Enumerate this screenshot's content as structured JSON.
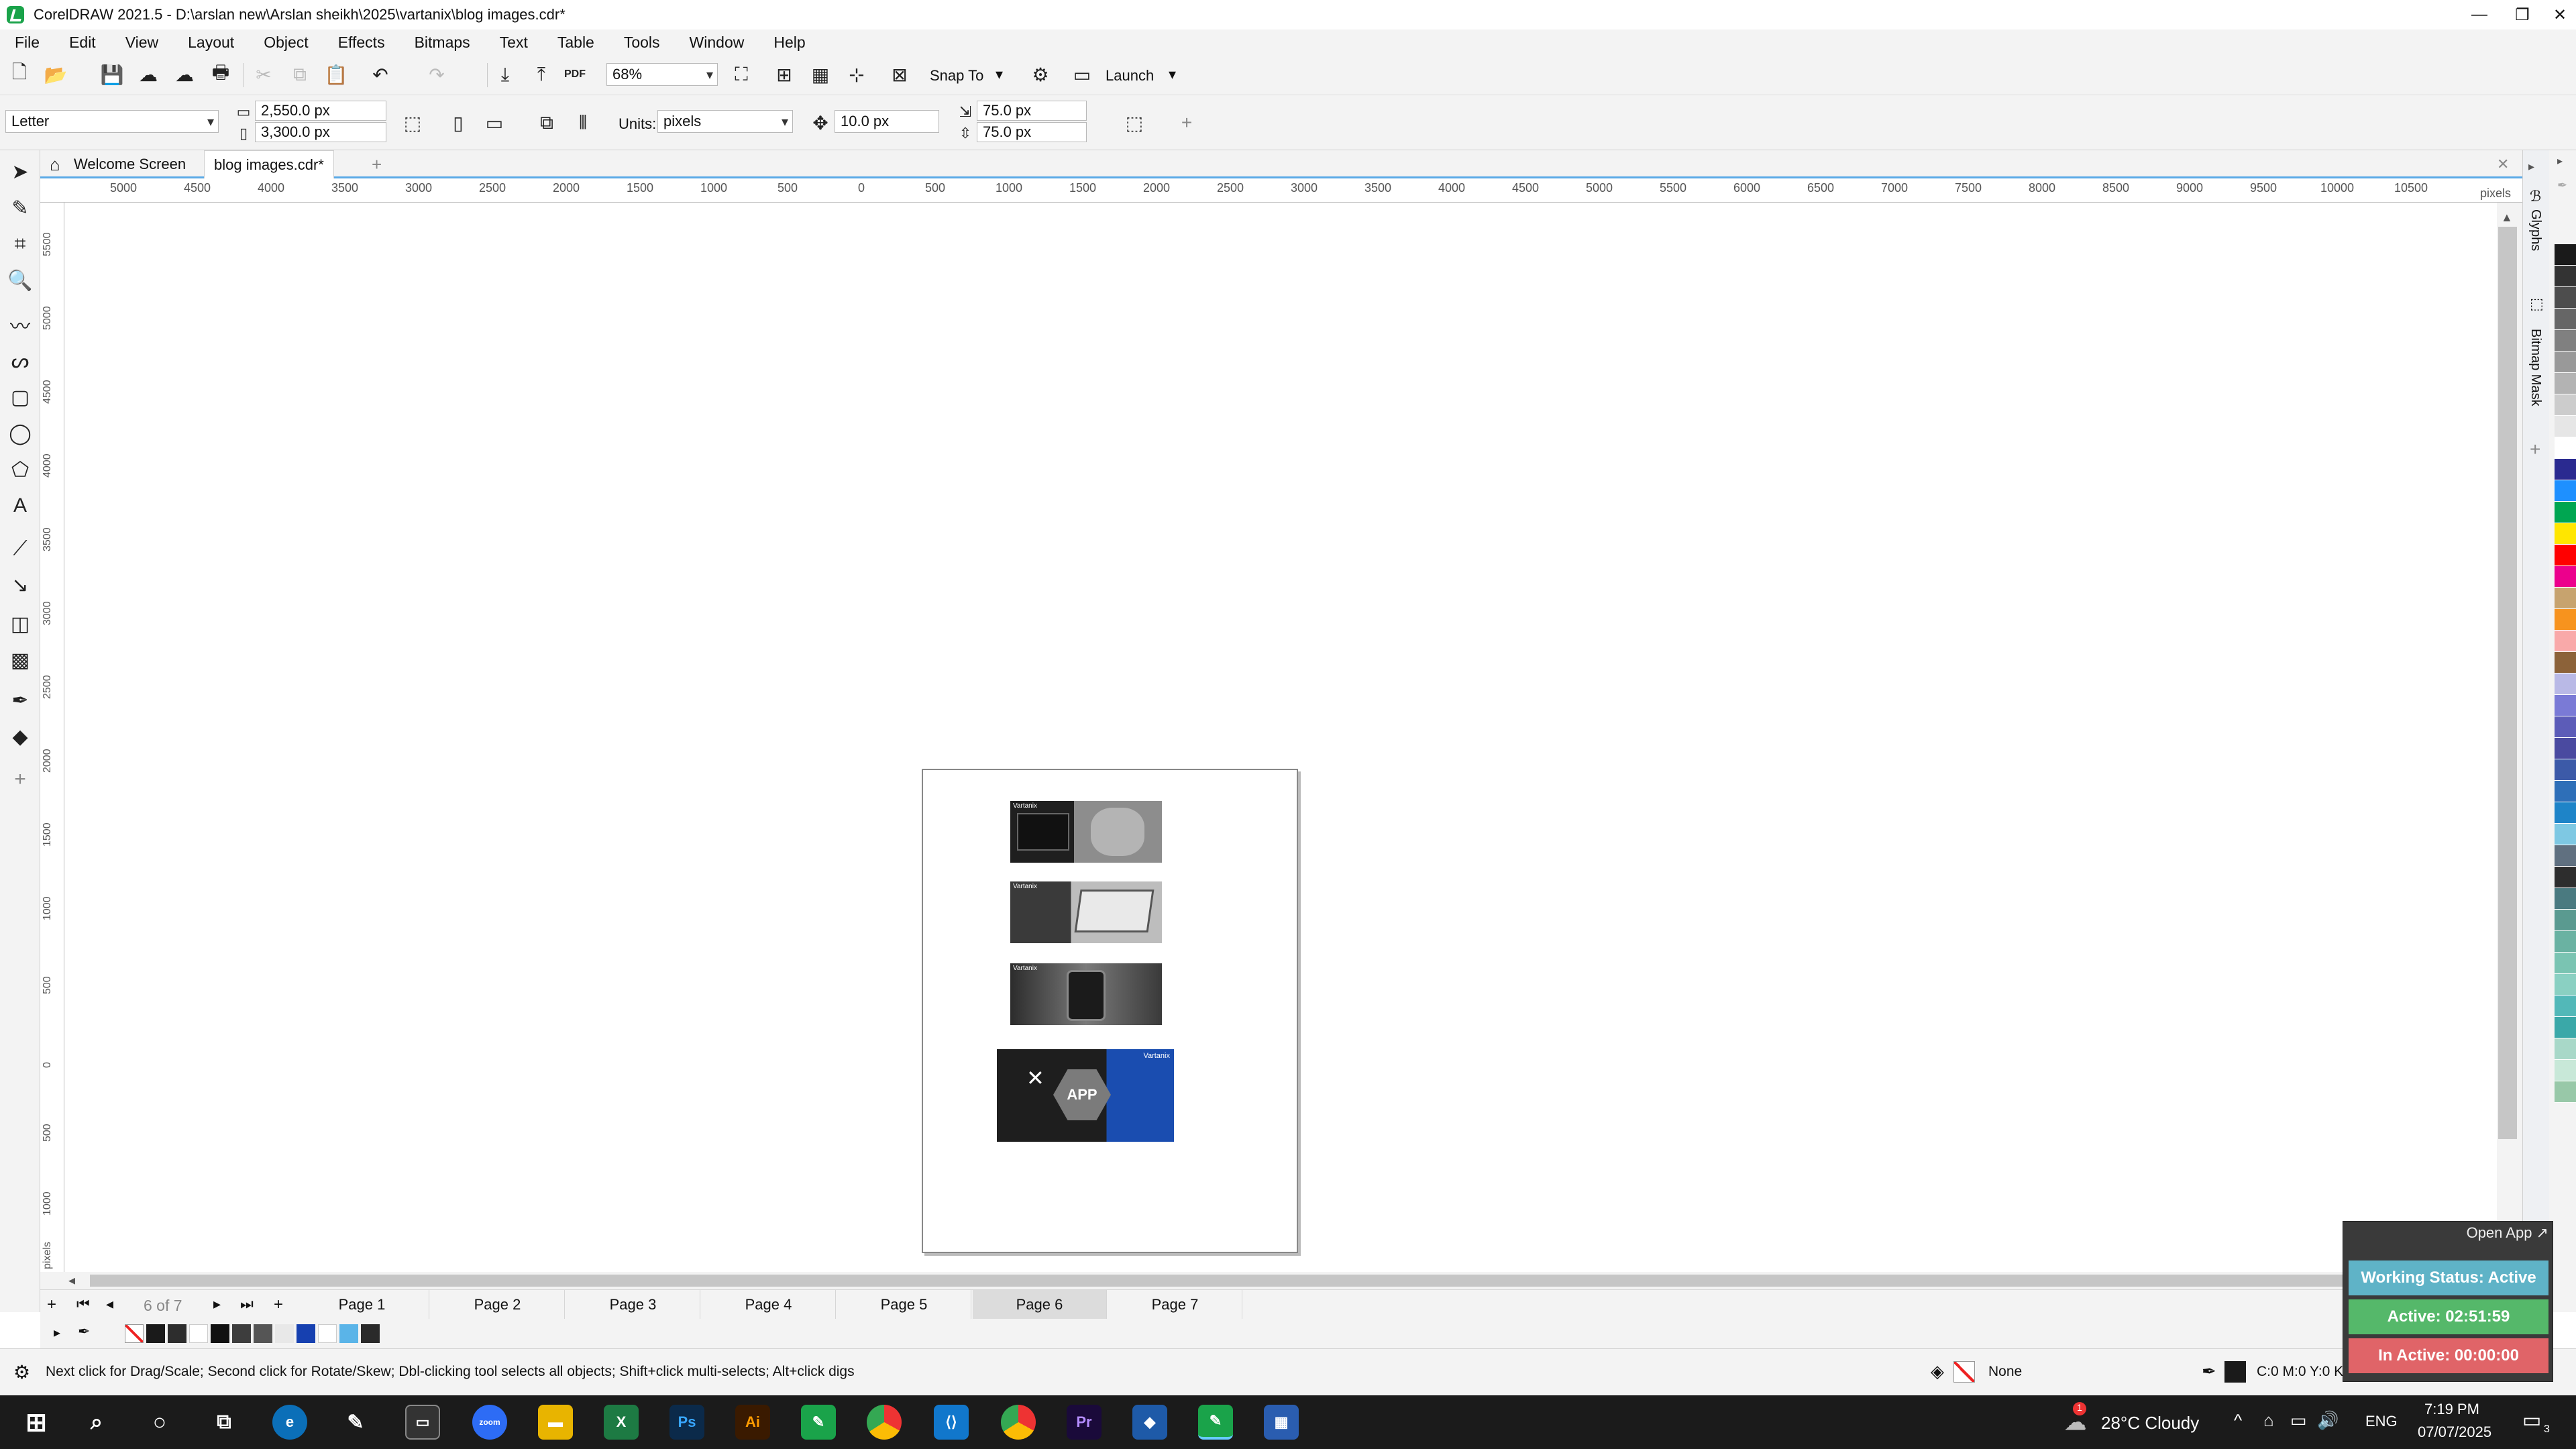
{
  "window": {
    "title": "CorelDRAW 2021.5 - D:\\arslan new\\Arslan sheikh\\2025\\vartanix\\blog images.cdr*"
  },
  "menu": [
    "File",
    "Edit",
    "View",
    "Layout",
    "Object",
    "Effects",
    "Bitmaps",
    "Text",
    "Table",
    "Tools",
    "Window",
    "Help"
  ],
  "toolbar": {
    "zoom": "68%",
    "snap_label": "Snap To",
    "launch_label": "Launch"
  },
  "propertybar": {
    "paper": "Letter",
    "width": "2,550.0 px",
    "height": "3,300.0 px",
    "units_label": "Units:",
    "units": "pixels",
    "nudge": "10.0 px",
    "dup_x": "75.0 px",
    "dup_y": "75.0 px"
  },
  "doctabs": [
    {
      "label": "Welcome Screen"
    },
    {
      "label": "blog images.cdr*"
    }
  ],
  "ruler": {
    "h_ticks": [
      "5000",
      "4500",
      "4000",
      "3500",
      "3000",
      "2500",
      "2000",
      "1500",
      "1000",
      "500",
      "0",
      "500",
      "1000",
      "1500",
      "2000",
      "2500",
      "3000",
      "3500",
      "4000",
      "4500",
      "5000",
      "5500",
      "6000",
      "6500",
      "7000",
      "7500",
      "8000",
      "8500",
      "9000",
      "9500",
      "10000",
      "10500"
    ],
    "h_unit": "pixels",
    "v_ticks": [
      "5500",
      "5000",
      "4500",
      "4000",
      "3500",
      "3000",
      "2500",
      "2000",
      "1500",
      "1000",
      "500",
      "0",
      "500",
      "1000"
    ],
    "v_unit": "pixels"
  },
  "docker": {
    "glyphs": "Glyphs",
    "bitmap_mask": "Bitmap Mask"
  },
  "pages": {
    "counter": "6 of 7",
    "tabs": [
      "Page 1",
      "Page 2",
      "Page 3",
      "Page 4",
      "Page 5",
      "Page 6",
      "Page 7"
    ],
    "active": "Page 6"
  },
  "status": {
    "hint": "Next click for Drag/Scale; Second click for Rotate/Skew; Dbl-clicking tool selects all objects; Shift+click multi-selects; Alt+click digs",
    "fill": "None",
    "outline": "C:0 M:0 Y:0 K:100 0.500 pt"
  },
  "widget": {
    "open_app": "Open App ↗",
    "working": "Working Status: Active",
    "active": "Active: 02:51:59",
    "inactive": "In Active: 00:00:00",
    "colors": {
      "working": "#5fb3c7",
      "active": "#55b86a",
      "inactive": "#e06468"
    }
  },
  "taskbar": {
    "weather": "28°C Cloudy",
    "lang": "ENG",
    "time": "7:19 PM",
    "date": "07/07/2025",
    "notif": "3",
    "weather_badge": "1"
  },
  "thumbs": [
    {
      "brand": "Vartanix"
    },
    {
      "brand": "Vartanix"
    },
    {
      "brand": "Vartanix"
    },
    {
      "brand": "Vartanix",
      "headline": "APP"
    }
  ]
}
